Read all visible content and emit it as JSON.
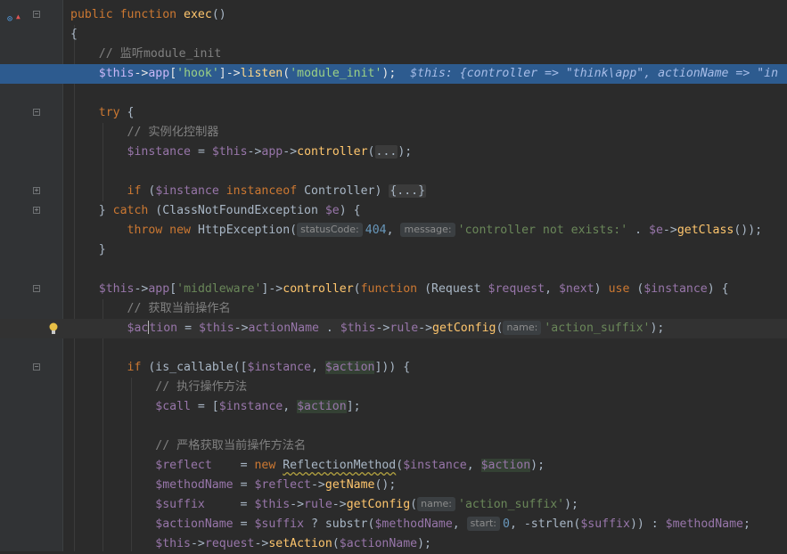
{
  "editor": {
    "lines": [
      {
        "tokens": [
          [
            "k",
            "public "
          ],
          [
            "k",
            "function "
          ],
          [
            "f",
            "exec"
          ],
          [
            "p",
            "()"
          ]
        ]
      },
      {
        "tokens": [
          [
            "p",
            "{"
          ]
        ]
      },
      {
        "tokens": [
          [
            "c",
            "    // 监听module_init"
          ]
        ]
      },
      {
        "tokens": [
          [
            "p",
            "    "
          ],
          [
            "v",
            "$this"
          ],
          [
            "p",
            "->"
          ],
          [
            "v",
            "app"
          ],
          [
            "p",
            "["
          ],
          [
            "s",
            "'hook'"
          ],
          [
            "p",
            "]->"
          ],
          [
            "f",
            "listen"
          ],
          [
            "p",
            "("
          ],
          [
            "s",
            "'module_init'"
          ],
          [
            "p",
            ");  "
          ],
          [
            "dbg",
            "$this: {controller => \"think\\app\", actionName => \"in"
          ]
        ]
      },
      {
        "tokens": []
      },
      {
        "tokens": [
          [
            "p",
            "    "
          ],
          [
            "k",
            "try "
          ],
          [
            "p",
            "{"
          ]
        ]
      },
      {
        "tokens": [
          [
            "c",
            "        // 实例化控制器"
          ]
        ]
      },
      {
        "tokens": [
          [
            "p",
            "        "
          ],
          [
            "v",
            "$instance"
          ],
          [
            "p",
            " = "
          ],
          [
            "v",
            "$this"
          ],
          [
            "p",
            "->"
          ],
          [
            "v",
            "app"
          ],
          [
            "p",
            "->"
          ],
          [
            "f",
            "controller"
          ],
          [
            "p",
            "("
          ],
          [
            "fold",
            "..."
          ],
          [
            "p",
            ");"
          ]
        ]
      },
      {
        "tokens": []
      },
      {
        "tokens": [
          [
            "p",
            "        "
          ],
          [
            "k",
            "if "
          ],
          [
            "p",
            "("
          ],
          [
            "v",
            "$instance"
          ],
          [
            "p",
            " "
          ],
          [
            "k",
            "instanceof "
          ],
          [
            "p",
            "Controller) "
          ],
          [
            "fold",
            "{...}"
          ]
        ]
      },
      {
        "tokens": [
          [
            "p",
            "    } "
          ],
          [
            "k",
            "catch "
          ],
          [
            "p",
            "(ClassNotFoundException "
          ],
          [
            "v",
            "$e"
          ],
          [
            "p",
            ") {"
          ]
        ]
      },
      {
        "tokens": [
          [
            "p",
            "        "
          ],
          [
            "k",
            "throw new "
          ],
          [
            "p",
            "HttpException("
          ],
          [
            "hint",
            "statusCode:"
          ],
          [
            "n",
            "404"
          ],
          [
            "p",
            ", "
          ],
          [
            "hint",
            "message:"
          ],
          [
            "s",
            "'controller not exists:'"
          ],
          [
            "p",
            " . "
          ],
          [
            "v",
            "$e"
          ],
          [
            "p",
            "->"
          ],
          [
            "f",
            "getClass"
          ],
          [
            "p",
            "());"
          ]
        ]
      },
      {
        "tokens": [
          [
            "p",
            "    }"
          ]
        ]
      },
      {
        "tokens": []
      },
      {
        "tokens": [
          [
            "p",
            "    "
          ],
          [
            "v",
            "$this"
          ],
          [
            "p",
            "->"
          ],
          [
            "v",
            "app"
          ],
          [
            "p",
            "["
          ],
          [
            "s",
            "'middleware'"
          ],
          [
            "p",
            "]->"
          ],
          [
            "f",
            "controller"
          ],
          [
            "p",
            "("
          ],
          [
            "k",
            "function "
          ],
          [
            "p",
            "(Request "
          ],
          [
            "v",
            "$request"
          ],
          [
            "p",
            ", "
          ],
          [
            "v",
            "$next"
          ],
          [
            "p",
            ") "
          ],
          [
            "k",
            "use "
          ],
          [
            "p",
            "("
          ],
          [
            "v",
            "$instance"
          ],
          [
            "p",
            ") {"
          ]
        ]
      },
      {
        "tokens": [
          [
            "c",
            "        // 获取当前操作名"
          ]
        ]
      },
      {
        "tokens": [
          [
            "p",
            "        "
          ],
          [
            "v",
            "$ac"
          ],
          [
            "caret",
            ""
          ],
          [
            "v",
            "tion"
          ],
          [
            "p",
            " = "
          ],
          [
            "v",
            "$this"
          ],
          [
            "p",
            "->"
          ],
          [
            "v",
            "actionName"
          ],
          [
            "p",
            " . "
          ],
          [
            "v",
            "$this"
          ],
          [
            "p",
            "->"
          ],
          [
            "v",
            "rule"
          ],
          [
            "p",
            "->"
          ],
          [
            "f",
            "getConfig"
          ],
          [
            "p",
            "("
          ],
          [
            "hint",
            "name:"
          ],
          [
            "s",
            "'action_suffix'"
          ],
          [
            "p",
            ");"
          ]
        ]
      },
      {
        "tokens": []
      },
      {
        "tokens": [
          [
            "p",
            "        "
          ],
          [
            "k",
            "if "
          ],
          [
            "p",
            "(is_callable(["
          ],
          [
            "v",
            "$instance"
          ],
          [
            "p",
            ", "
          ],
          [
            "usage",
            "$action"
          ],
          [
            "p",
            "])) {"
          ]
        ]
      },
      {
        "tokens": [
          [
            "c",
            "            // 执行操作方法"
          ]
        ]
      },
      {
        "tokens": [
          [
            "p",
            "            "
          ],
          [
            "v",
            "$call"
          ],
          [
            "p",
            " = ["
          ],
          [
            "v",
            "$instance"
          ],
          [
            "p",
            ", "
          ],
          [
            "usage",
            "$action"
          ],
          [
            "p",
            "];"
          ]
        ]
      },
      {
        "tokens": []
      },
      {
        "tokens": [
          [
            "c",
            "            // 严格获取当前操作方法名"
          ]
        ]
      },
      {
        "tokens": [
          [
            "p",
            "            "
          ],
          [
            "v",
            "$reflect"
          ],
          [
            "p",
            "    = "
          ],
          [
            "k",
            "new "
          ],
          [
            "squig",
            "ReflectionMethod"
          ],
          [
            "p",
            "("
          ],
          [
            "v",
            "$instance"
          ],
          [
            "p",
            ", "
          ],
          [
            "usage",
            "$action"
          ],
          [
            "p",
            ");"
          ]
        ]
      },
      {
        "tokens": [
          [
            "p",
            "            "
          ],
          [
            "v",
            "$methodName"
          ],
          [
            "p",
            " = "
          ],
          [
            "v",
            "$reflect"
          ],
          [
            "p",
            "->"
          ],
          [
            "f",
            "getName"
          ],
          [
            "p",
            "();"
          ]
        ]
      },
      {
        "tokens": [
          [
            "p",
            "            "
          ],
          [
            "v",
            "$suffix"
          ],
          [
            "p",
            "     = "
          ],
          [
            "v",
            "$this"
          ],
          [
            "p",
            "->"
          ],
          [
            "v",
            "rule"
          ],
          [
            "p",
            "->"
          ],
          [
            "f",
            "getConfig"
          ],
          [
            "p",
            "("
          ],
          [
            "hint",
            "name:"
          ],
          [
            "s",
            "'action_suffix'"
          ],
          [
            "p",
            ");"
          ]
        ]
      },
      {
        "tokens": [
          [
            "p",
            "            "
          ],
          [
            "v",
            "$actionName"
          ],
          [
            "p",
            " = "
          ],
          [
            "v",
            "$suffix"
          ],
          [
            "p",
            " ? substr("
          ],
          [
            "v",
            "$methodName"
          ],
          [
            "p",
            ", "
          ],
          [
            "hint",
            "start:"
          ],
          [
            "n",
            "0"
          ],
          [
            "p",
            ", -strlen("
          ],
          [
            "v",
            "$suffix"
          ],
          [
            "p",
            ")) : "
          ],
          [
            "v",
            "$methodName"
          ],
          [
            "p",
            ";"
          ]
        ]
      },
      {
        "tokens": [
          [
            "p",
            "            "
          ],
          [
            "v",
            "$this"
          ],
          [
            "p",
            "->"
          ],
          [
            "v",
            "request"
          ],
          [
            "p",
            "->"
          ],
          [
            "f",
            "setAction"
          ],
          [
            "p",
            "("
          ],
          [
            "v",
            "$actionName"
          ],
          [
            "p",
            ");"
          ]
        ]
      }
    ]
  }
}
